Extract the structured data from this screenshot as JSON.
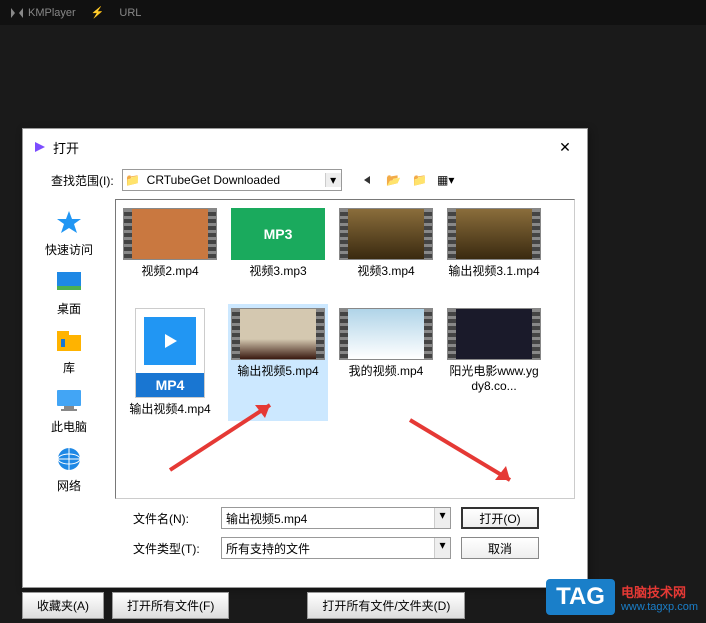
{
  "app": {
    "name": "KMPlayer",
    "url_label": "URL"
  },
  "dialog": {
    "title": "打开",
    "search_label": "查找范围(I):",
    "folder": "CRTubeGet Downloaded",
    "filename_label": "文件名(N):",
    "filename_value": "输出视频5.mp4",
    "filetype_label": "文件类型(T):",
    "filetype_value": "所有支持的文件",
    "open_btn": "打开(O)",
    "cancel_btn": "取消"
  },
  "sidebar": [
    {
      "label": "快速访问",
      "icon": "star"
    },
    {
      "label": "桌面",
      "icon": "desktop"
    },
    {
      "label": "库",
      "icon": "library"
    },
    {
      "label": "此电脑",
      "icon": "pc"
    },
    {
      "label": "网络",
      "icon": "network"
    }
  ],
  "files_row1": [
    {
      "name": "视频2.mp4",
      "type": "video"
    },
    {
      "name": "视频3.mp3",
      "type": "mp3"
    },
    {
      "name": "视频3.mp4",
      "type": "video"
    },
    {
      "name": "输出视频3.1.mp4",
      "type": "video"
    }
  ],
  "files_row2": [
    {
      "name": "输出视频4.mp4",
      "type": "mp4icon"
    },
    {
      "name": "输出视频5.mp4",
      "type": "video",
      "selected": true
    },
    {
      "name": "我的视频.mp4",
      "type": "video"
    },
    {
      "name": "阳光电影www.ygdy8.co...",
      "type": "video"
    }
  ],
  "bottom_buttons": [
    "收藏夹(A)",
    "打开所有文件(F)",
    "打开所有文件/文件夹(D)"
  ],
  "tag": {
    "box": "TAG",
    "cn": "电脑技术网",
    "url": "www.tagxp.com"
  }
}
